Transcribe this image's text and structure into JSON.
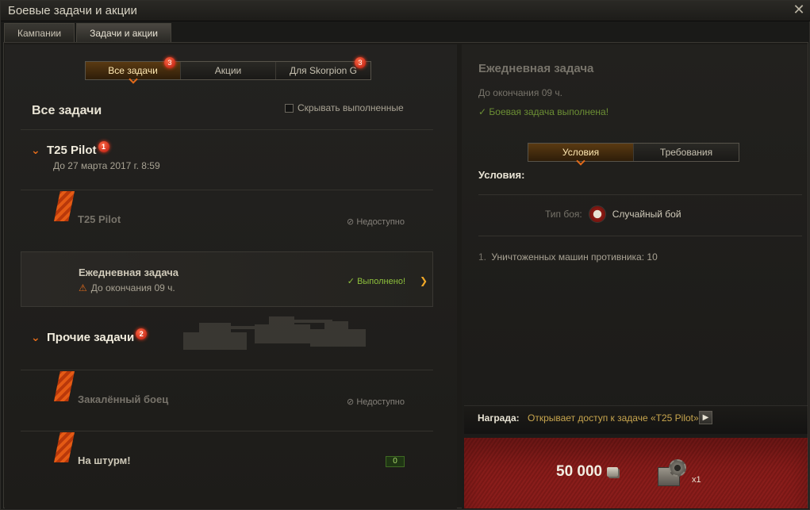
{
  "window": {
    "title": "Боевые задачи и акции"
  },
  "top_tabs": [
    {
      "label": "Кампании",
      "active": false
    },
    {
      "label": "Задачи и акции",
      "active": true
    }
  ],
  "left": {
    "filter_tabs": [
      {
        "label": "Все задачи",
        "badge": "3",
        "active": true
      },
      {
        "label": "Акции",
        "badge": "",
        "active": false
      },
      {
        "label": "Для Skorpion G",
        "badge": "3",
        "active": false
      }
    ],
    "section_title": "Все задачи",
    "hide_completed_label": "Скрывать выполненные",
    "groups": [
      {
        "title": "T25 Pilot",
        "badge": "1",
        "subtitle": "До 27 марта 2017 г. 8:59",
        "tasks": [
          {
            "name": "T25 Pilot",
            "status": "Недоступно"
          },
          {
            "name": "Ежедневная задача",
            "deadline": "До окончания 09 ч.",
            "status": "Выполнено!"
          }
        ]
      },
      {
        "title": "Прочие задачи",
        "badge": "2",
        "tasks": [
          {
            "name": "Закалённый боец",
            "status": "Недоступно"
          },
          {
            "name": "На штурм!",
            "counter": "0"
          }
        ]
      }
    ]
  },
  "right": {
    "title": "Ежедневная задача",
    "deadline": "До окончания 09 ч.",
    "completed": "Боевая задача выполнена!",
    "tabs": [
      {
        "label": "Условия",
        "active": true
      },
      {
        "label": "Требования",
        "active": false
      }
    ],
    "conditions_label": "Условия:",
    "battle_type_label": "Тип боя:",
    "battle_type_value": "Случайный бой",
    "condition_items": [
      {
        "num": "1.",
        "text": "Уничтоженных машин противника:",
        "value": "10"
      }
    ],
    "reward_label": "Награда:",
    "reward_text": "Открывает доступ к задаче «T25 Pilot»",
    "credits": "50 000",
    "item_count": "x1"
  },
  "colors": {
    "accent": "#e06a1b",
    "success": "#8ec13c",
    "reward_bg": "#8a1d1b",
    "gold_text": "#c8a64e"
  }
}
